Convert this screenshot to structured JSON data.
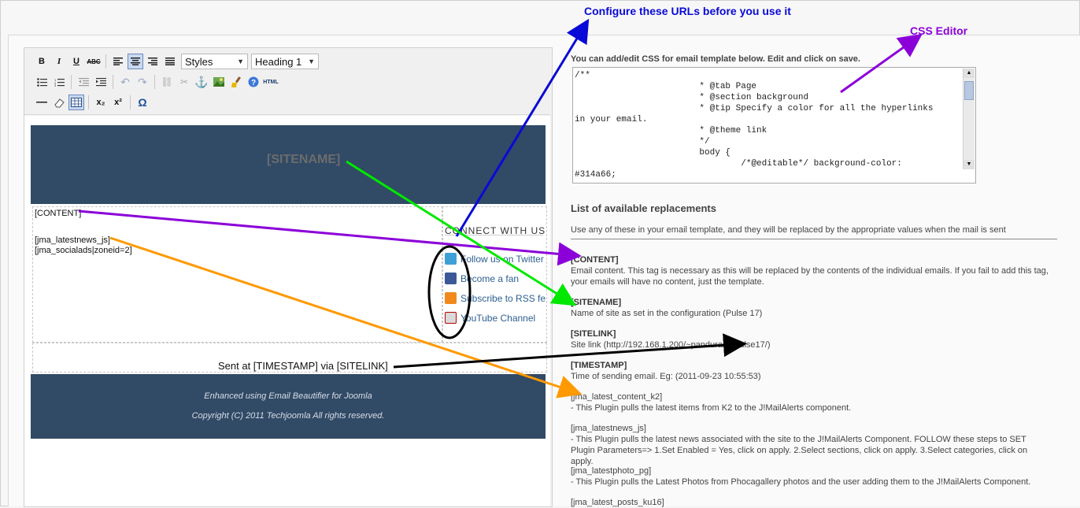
{
  "annotations": {
    "configure_urls": "Configure these URLs before you use it",
    "css_editor": "CSS Editor",
    "colors": {
      "blue": "#0a0ad6",
      "purple": "#8b00d9",
      "green": "#00e800",
      "orange": "#ff9900",
      "black": "#000000"
    }
  },
  "toolbar": {
    "bold": "B",
    "italic": "I",
    "underline": "U",
    "strike": "ABC",
    "styles_select": "Styles",
    "format_select": "Heading 1",
    "row2_icons": [
      "bullet-list-icon",
      "numbered-list-icon",
      "outdent-icon",
      "indent-icon",
      "undo-icon",
      "redo-icon",
      "link-icon",
      "unlink-icon",
      "anchor-icon",
      "image-icon",
      "cleanup-icon",
      "help-icon",
      "html-icon"
    ],
    "html_label": "HTML",
    "row3": {
      "subscript": "x₂",
      "superscript": "x²",
      "omega": "Ω"
    }
  },
  "email": {
    "sitename": "[SITENAME]",
    "content_tag": "[CONTENT]",
    "latestnews_tag": "[jma_latestnews_js]",
    "socialads_tag": "[jma_socialads|zoneid=2]",
    "connect_heading": "CONNECT WITH US",
    "social": [
      {
        "label": "Follow us on Twitter",
        "icon": "twitter-icon",
        "color": "#3fa0d8"
      },
      {
        "label": "Become a fan",
        "icon": "facebook-icon",
        "color": "#3b5998"
      },
      {
        "label": "Subscribe to RSS fe",
        "icon": "rss-icon",
        "color": "#f08a1c"
      },
      {
        "label": "YouTube Channel",
        "icon": "youtube-icon",
        "color": "#d9d9d9"
      }
    ],
    "sent_line": "Sent at [TIMESTAMP] via [SITELINK]",
    "footer_line1": "Enhanced using Email Beautifier for Joomla",
    "footer_line2": "Copyright (C) 2011 Techjoomla All rights reserved.",
    "banner_color": "#314a66"
  },
  "css_panel": {
    "intro": "You can add/edit CSS for email template below. Edit and click on save.",
    "code": "/**\n                        * @tab Page\n                        * @section background\n                        * @tip Specify a color for all the hyperlinks\nin your email.\n                        * @theme link\n                        */\n                        body {\n                                /*@editable*/ background-color:\n#314a66;"
  },
  "replacements": {
    "heading": "List of available replacements",
    "description": "Use any of these in your email template, and they will be replaced by the appropriate values when the mail is sent",
    "items": [
      {
        "tag": "[CONTENT]",
        "text": "Email content. This tag is necessary as this will be replaced by the contents of the individual emails. If you fail to add this tag, your emails will have no content, just the template."
      },
      {
        "tag": "[SITENAME]",
        "text": "Name of site as set in the configuration (Pulse 17)"
      },
      {
        "tag": "[SITELINK]",
        "text": "Site link (http://192.168.1.200/~pandurang/pulse17/)"
      },
      {
        "tag": "[TIMESTAMP]",
        "text": "Time of sending email. Eg: (2011-09-23 10:55:53)"
      },
      {
        "tag": "[jma_latest_content_k2]",
        "text": "- This Plugin pulls the latest items from K2 to the J!MailAlerts component."
      },
      {
        "tag": "[jma_latestnews_js]",
        "text": "- This Plugin pulls the latest news associated with the site to the J!MailAlerts Component. FOLLOW these steps to SET Plugin Parameters=> 1.Set Enabled = Yes, click on apply. 2.Select sections, click on apply. 3.Select categories, click on apply."
      },
      {
        "tag": "[jma_latestphoto_pg]",
        "text": "- This Plugin pulls the Latest Photos from Phocagallery photos and the user adding them to the J!MailAlerts Component."
      },
      {
        "tag": "[jma_latest_posts_ku16]",
        "text": ""
      }
    ]
  }
}
